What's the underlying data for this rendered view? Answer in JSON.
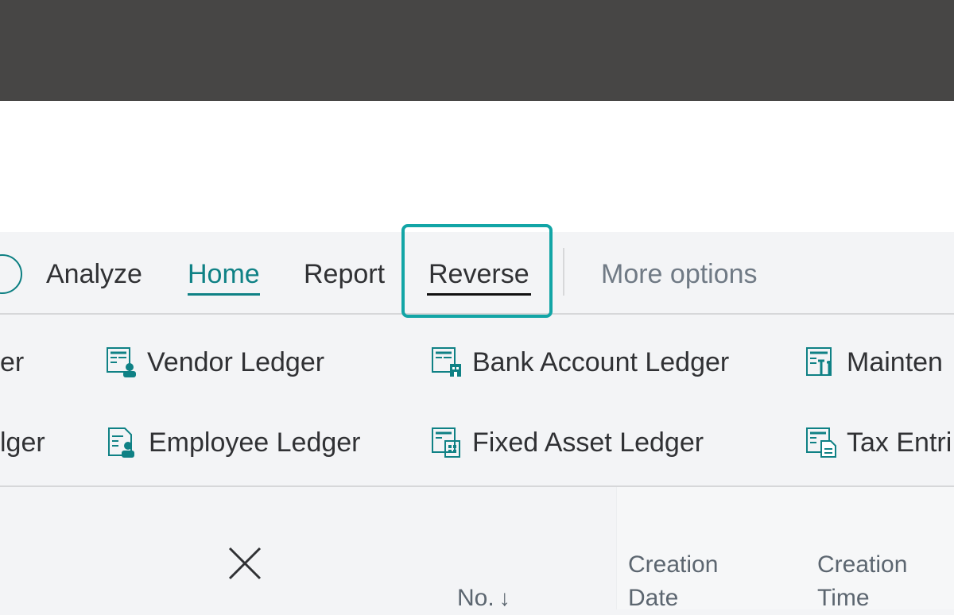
{
  "tabs": {
    "analyze": "Analyze",
    "home": "Home",
    "report": "Report",
    "reverse": "Reverse",
    "more": "More options"
  },
  "ledgers": {
    "row1": [
      {
        "label": "er",
        "icon": "ledger-icon"
      },
      {
        "label": "Vendor Ledger",
        "icon": "vendor-ledger-icon"
      },
      {
        "label": "Bank Account Ledger",
        "icon": "bank-account-ledger-icon"
      },
      {
        "label": "Mainten",
        "icon": "maintenance-ledger-icon"
      }
    ],
    "row2": [
      {
        "label": "lger",
        "icon": "ledger-icon"
      },
      {
        "label": "Employee Ledger",
        "icon": "employee-ledger-icon"
      },
      {
        "label": "Fixed Asset Ledger",
        "icon": "fixed-asset-ledger-icon"
      },
      {
        "label": "Tax Entri",
        "icon": "tax-entries-icon"
      }
    ]
  },
  "columns": {
    "no": "No.",
    "creation_date_1": "Creation",
    "creation_date_2": "Date",
    "creation_time_1": "Creation",
    "creation_time_2": "Time"
  },
  "colors": {
    "accent": "#0f8185",
    "highlight": "#12a5a6",
    "topbar": "#474645"
  }
}
